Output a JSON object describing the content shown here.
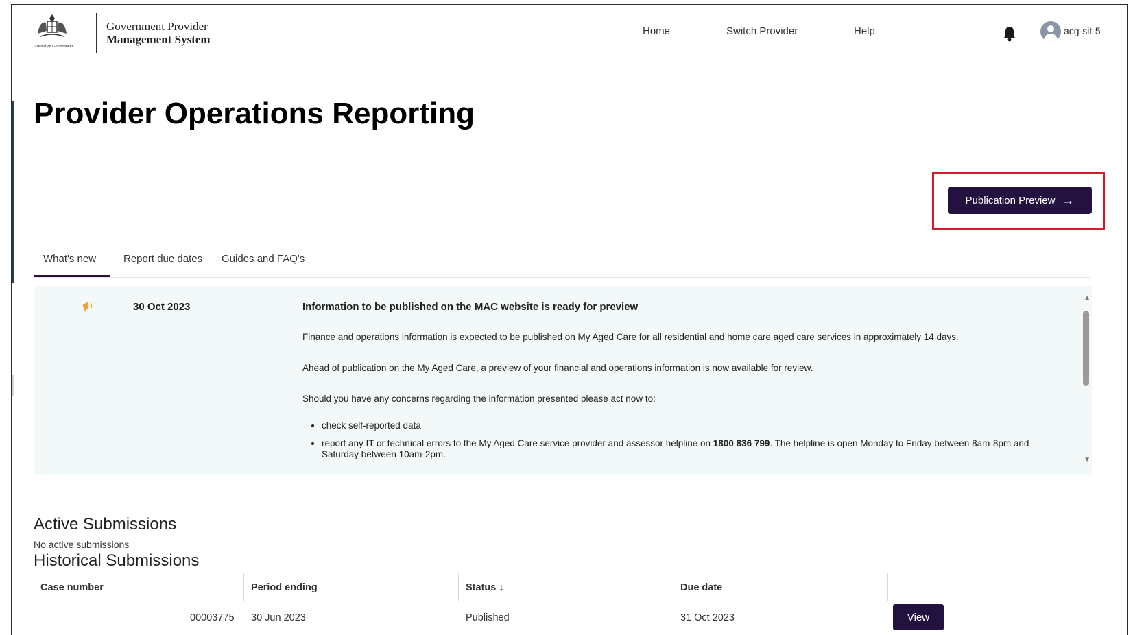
{
  "header": {
    "logo_text": "Australian Government",
    "brand_line1": "Government Provider",
    "brand_line2": "Management System",
    "nav": [
      {
        "label": "Home"
      },
      {
        "label": "Switch Provider"
      },
      {
        "label": "Help"
      }
    ],
    "bell_icon": "bell-icon",
    "user_icon": "user-avatar-icon",
    "username": "acg-sit-5"
  },
  "page": {
    "title": "Provider Operations Reporting",
    "publication_button": "Publication Preview",
    "publication_arrow": "→",
    "highlight_color": "#d7192b",
    "accent_color": "#23123f"
  },
  "tabs": [
    {
      "label": "What's new",
      "active": true
    },
    {
      "label": "Report due dates",
      "active": false
    },
    {
      "label": "Guides and FAQ's",
      "active": false
    }
  ],
  "news": {
    "icon": "megaphone-icon",
    "date": "30 Oct 2023",
    "heading": "Information to be published on the MAC website is ready for preview",
    "paragraphs": [
      "Finance and operations information is expected to be published on My Aged Care for all residential and home care aged care services in approximately 14 days.",
      "Ahead of publication on the My Aged Care, a preview of your financial and operations information is now available for review.",
      "Should you have any concerns regarding the information presented please act now to:"
    ],
    "bullets": {
      "item1": "check self-reported data",
      "item2_pre": "report any IT or technical errors to the My Aged Care service provider and assessor helpline on ",
      "item2_phone": "1800 836 799",
      "item2_post": ". The helpline is open Monday to Friday between 8am-8pm and Saturday between 10am-2pm."
    }
  },
  "active_submissions": {
    "heading": "Active Submissions",
    "empty_text": "No active submissions"
  },
  "historical_submissions": {
    "heading": "Historical Submissions",
    "columns": [
      "Case number",
      "Period ending",
      "Status ↓",
      "Due date"
    ],
    "rows": [
      {
        "case_number": "00003775",
        "period_ending": "30 Jun 2023",
        "status": "Published",
        "due_date": "31 Oct 2023",
        "action": "View"
      }
    ]
  }
}
